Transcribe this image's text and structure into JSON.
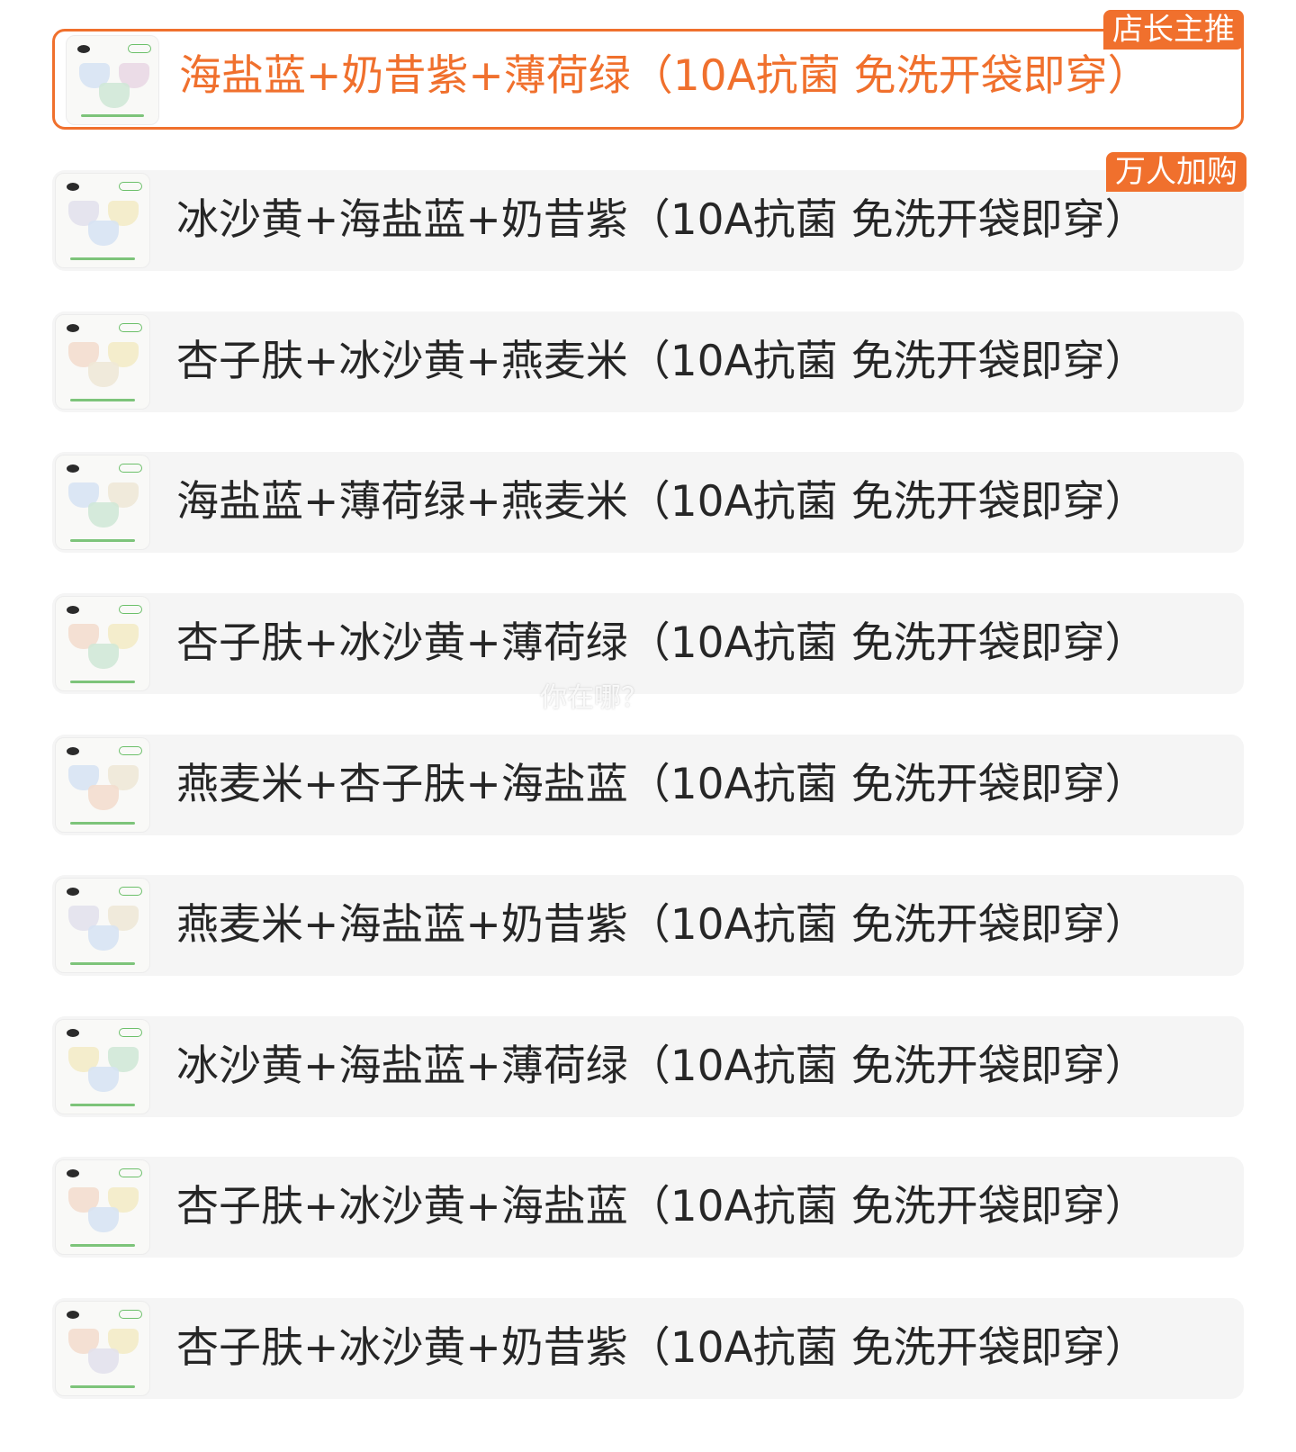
{
  "colors": {
    "accent": "#f0702d",
    "card_bg": "#f5f5f5",
    "text": "#262626"
  },
  "options": [
    {
      "label": "海盐蓝+奶昔紫+薄荷绿（10A抗菌 免洗开袋即穿）",
      "selected": true,
      "badge": "店长主推",
      "colors": [
        "#d6e3f3",
        "#e9d7e4",
        "#cfe8d6"
      ]
    },
    {
      "label": "冰沙黄+海盐蓝+奶昔紫（10A抗菌 免洗开袋即穿）",
      "selected": false,
      "badge": "万人加购",
      "colors": [
        "#e2e0ec",
        "#f3ebc4",
        "#d6e3f3"
      ]
    },
    {
      "label": "杏子肤+冰沙黄+燕麦米（10A抗菌 免洗开袋即穿）",
      "selected": false,
      "badge": "",
      "colors": [
        "#f3dccd",
        "#f3ebc4",
        "#efe7d6"
      ]
    },
    {
      "label": "海盐蓝+薄荷绿+燕麦米（10A抗菌 免洗开袋即穿）",
      "selected": false,
      "badge": "",
      "colors": [
        "#d6e3f3",
        "#efe7d6",
        "#cfe8d6"
      ]
    },
    {
      "label": "杏子肤+冰沙黄+薄荷绿（10A抗菌 免洗开袋即穿）",
      "selected": false,
      "badge": "",
      "colors": [
        "#f3dccd",
        "#f3ebc4",
        "#cfe8d6"
      ]
    },
    {
      "label": "燕麦米+杏子肤+海盐蓝（10A抗菌 免洗开袋即穿）",
      "selected": false,
      "badge": "",
      "colors": [
        "#d6e3f3",
        "#efe7d6",
        "#f3dccd"
      ]
    },
    {
      "label": "燕麦米+海盐蓝+奶昔紫（10A抗菌 免洗开袋即穿）",
      "selected": false,
      "badge": "",
      "colors": [
        "#e2e0ec",
        "#efe7d6",
        "#d6e3f3"
      ]
    },
    {
      "label": "冰沙黄+海盐蓝+薄荷绿（10A抗菌 免洗开袋即穿）",
      "selected": false,
      "badge": "",
      "colors": [
        "#f3ebc4",
        "#cfe8d6",
        "#d6e3f3"
      ]
    },
    {
      "label": "杏子肤+冰沙黄+海盐蓝（10A抗菌 免洗开袋即穿）",
      "selected": false,
      "badge": "",
      "colors": [
        "#f3dccd",
        "#f3ebc4",
        "#d6e3f3"
      ]
    },
    {
      "label": "杏子肤+冰沙黄+奶昔紫（10A抗菌 免洗开袋即穿）",
      "selected": false,
      "badge": "",
      "colors": [
        "#f3dccd",
        "#f3ebc4",
        "#e2e0ec"
      ]
    }
  ],
  "watermark": "你在哪？"
}
